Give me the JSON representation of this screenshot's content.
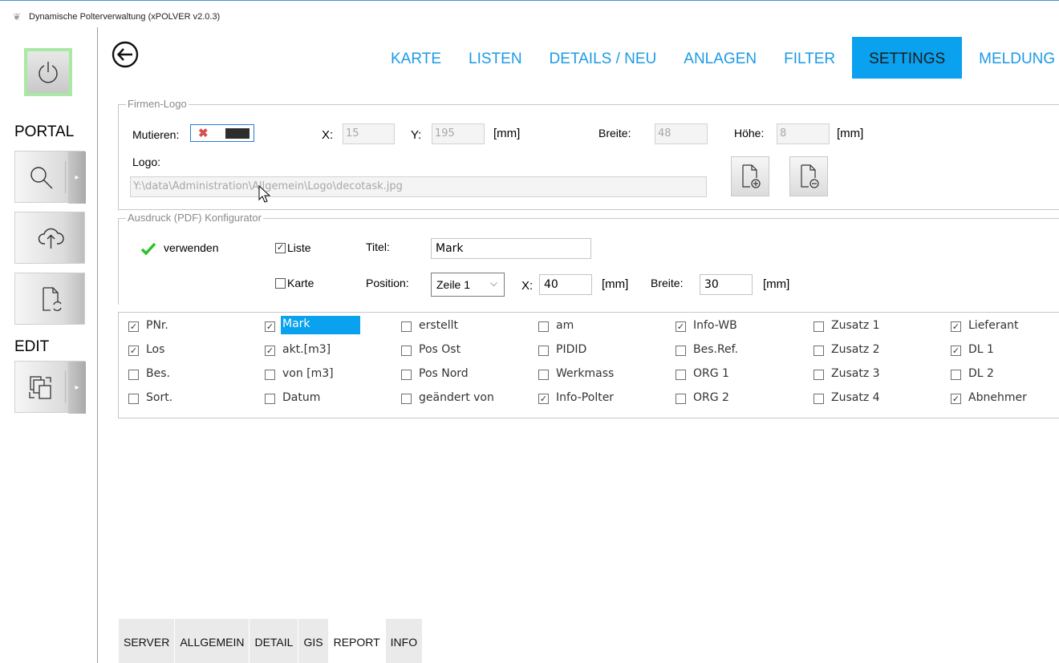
{
  "window": {
    "title": "Dynamische Polterverwaltung (xPOLVER v2.0.3)"
  },
  "sidebar": {
    "portal_label": "PORTAL",
    "edit_label": "EDIT",
    "buttons": [
      "power-icon",
      "search-icon",
      "cloud-upload-icon",
      "document-refresh-icon",
      "swap-documents-icon"
    ]
  },
  "nav": {
    "items": [
      "KARTE",
      "LISTEN",
      "DETAILS / NEU",
      "ANLAGEN",
      "FILTER",
      "SETTINGS",
      "MELDUNG"
    ],
    "active": "SETTINGS",
    "accent": "#0aa1ee"
  },
  "firmen_logo": {
    "legend": "Firmen-Logo",
    "mutieren_label": "Mutieren:",
    "x_label": "X:",
    "x_value": "15",
    "y_label": "Y:",
    "y_value": "195",
    "unit1": "[mm]",
    "breite_label": "Breite:",
    "breite_value": "48",
    "hoehe_label": "Höhe:",
    "hoehe_value": "8",
    "unit2": "[mm]",
    "logo_label": "Logo:",
    "logo_path": "Y:\\data\\Administration\\Allgemein\\Logo\\decotask.jpg"
  },
  "ausdruck": {
    "legend": "Ausdruck (PDF) Konfigurator",
    "verwenden_label": "verwenden",
    "liste_label": "Liste",
    "karte_label": "Karte",
    "titel_label": "Titel:",
    "titel_value": "Mark",
    "position_label": "Position:",
    "position_value": "Zeile 1",
    "x_label": "X:",
    "x_value": "40",
    "unit1": "[mm]",
    "breite_label": "Breite:",
    "breite_value": "30",
    "unit2": "[mm]"
  },
  "columns": [
    [
      {
        "label": "PNr.",
        "checked": true
      },
      {
        "label": "Los",
        "checked": true
      },
      {
        "label": "Bes.",
        "checked": false
      },
      {
        "label": "Sort.",
        "checked": false
      }
    ],
    [
      {
        "label": "Mark",
        "checked": true
      },
      {
        "label": "akt.[m3]",
        "checked": true
      },
      {
        "label": "von [m3]",
        "checked": false
      },
      {
        "label": "Datum",
        "checked": false
      }
    ],
    [
      {
        "label": "erstellt",
        "checked": false
      },
      {
        "label": "Pos Ost",
        "checked": false
      },
      {
        "label": "Pos Nord",
        "checked": false
      },
      {
        "label": "geändert von",
        "checked": false
      }
    ],
    [
      {
        "label": "am",
        "checked": false
      },
      {
        "label": "PIDID",
        "checked": false
      },
      {
        "label": "Werkmass",
        "checked": false
      },
      {
        "label": "Info-Polter",
        "checked": true
      }
    ],
    [
      {
        "label": "Info-WB",
        "checked": true
      },
      {
        "label": "Bes.Ref.",
        "checked": false
      },
      {
        "label": "ORG 1",
        "checked": false
      },
      {
        "label": "ORG 2",
        "checked": false
      }
    ],
    [
      {
        "label": "Zusatz 1",
        "checked": false
      },
      {
        "label": "Zusatz 2",
        "checked": false
      },
      {
        "label": "Zusatz 3",
        "checked": false
      },
      {
        "label": "Zusatz 4",
        "checked": false
      }
    ],
    [
      {
        "label": "Lieferant",
        "checked": true
      },
      {
        "label": "DL 1",
        "checked": true
      },
      {
        "label": "DL 2",
        "checked": false
      },
      {
        "label": "Abnehmer",
        "checked": true
      }
    ]
  ],
  "tabs": {
    "items": [
      "SERVER",
      "ALLGEMEIN",
      "DETAIL",
      "GIS",
      "REPORT",
      "INFO"
    ],
    "active": "REPORT"
  }
}
